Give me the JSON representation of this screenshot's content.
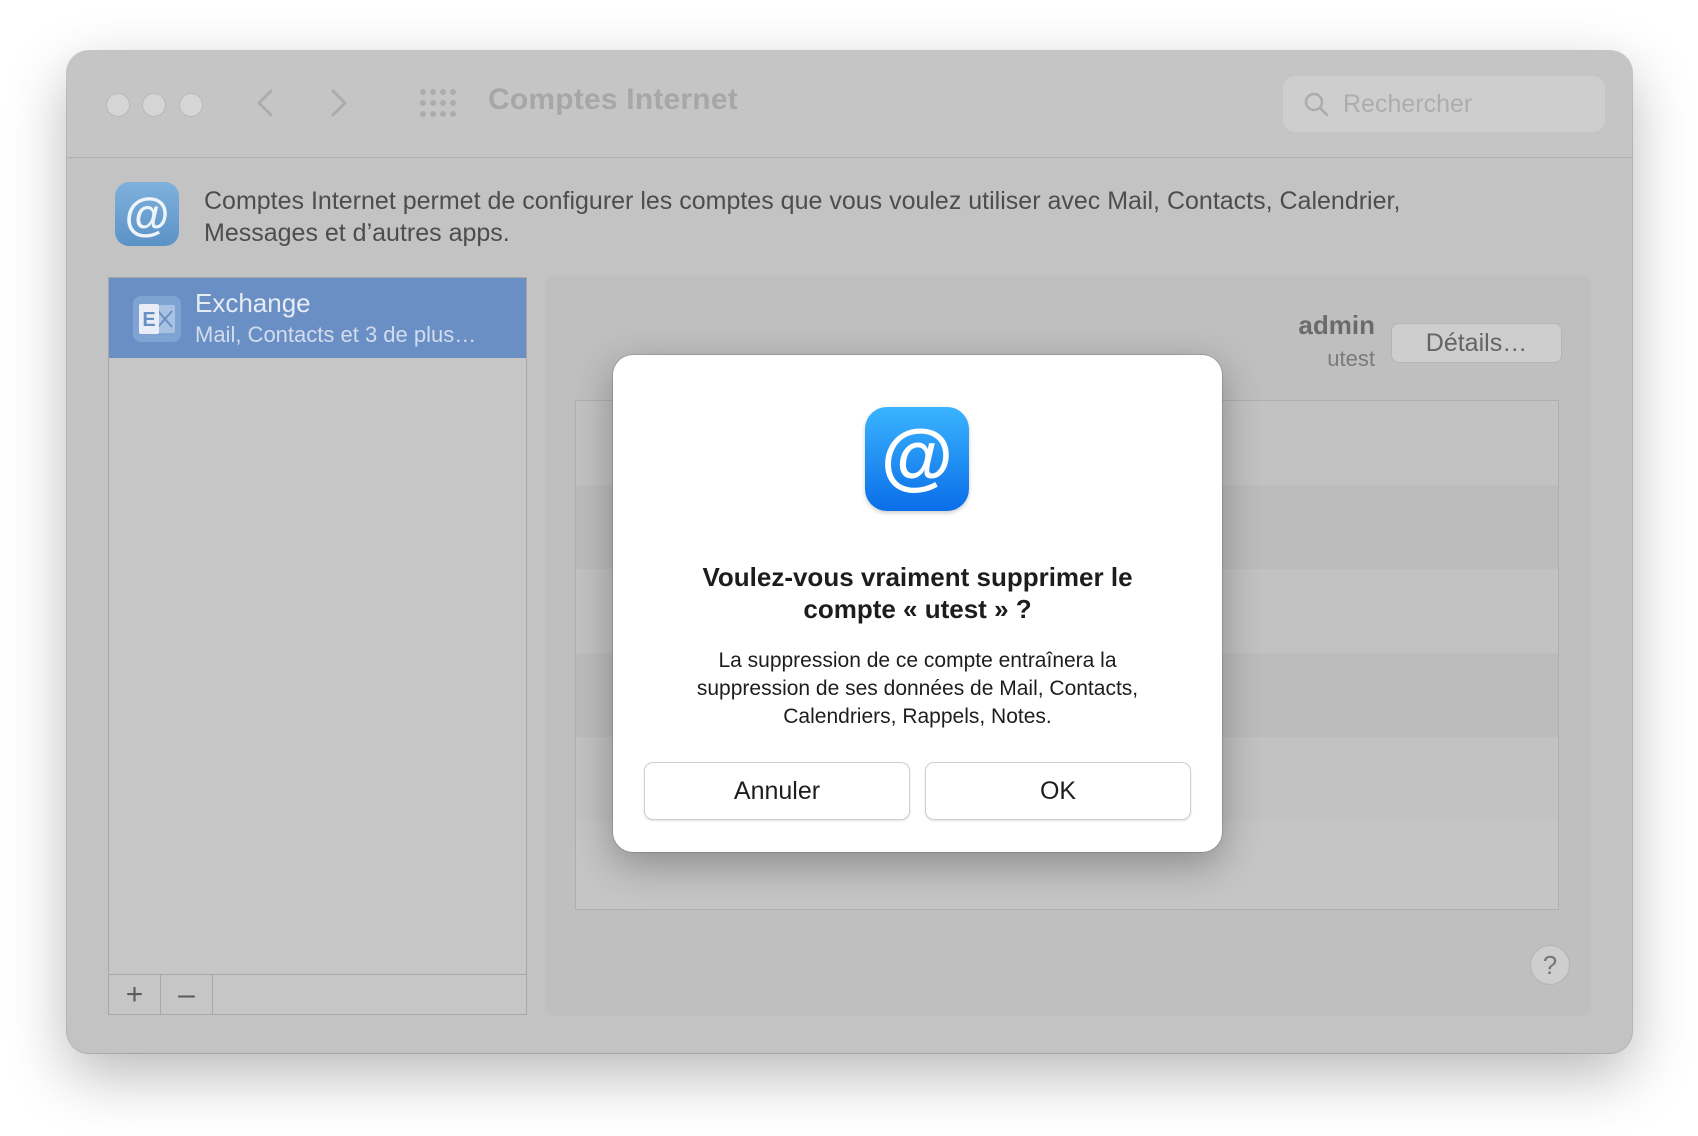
{
  "window": {
    "title": "Comptes Internet"
  },
  "search": {
    "placeholder": "Rechercher"
  },
  "description": {
    "line1": "Comptes Internet permet de configurer les comptes que vous voulez utiliser avec Mail, Contacts, Calendrier,",
    "line2": "Messages et d’autres apps."
  },
  "sidebar": {
    "accounts": [
      {
        "name": "Exchange",
        "subtitle": "Mail, Contacts et 3 de plus…",
        "selected": true
      }
    ],
    "add_label": "+",
    "remove_label": "–"
  },
  "account_detail": {
    "user_name": "admin",
    "user_sub": "utest",
    "details_label": "Détails…",
    "help_label": "?"
  },
  "dialog": {
    "title_line1": "Voulez-vous vraiment supprimer le",
    "title_line2": "compte « utest » ?",
    "message_line1": "La suppression de ce compte entraînera la",
    "message_line2": "suppression de ses données de Mail, Contacts,",
    "message_line3": "Calendriers, Rappels, Notes.",
    "cancel_label": "Annuler",
    "ok_label": "OK"
  },
  "icons": {
    "app_icon": "at-sign-icon",
    "account_icon": "exchange-icon",
    "search_icon": "magnifier-icon"
  },
  "colors": {
    "selection": "#6a8fc4",
    "dialog_icon_top": "#3bb4ff",
    "dialog_icon_bottom": "#0a6ee8"
  }
}
